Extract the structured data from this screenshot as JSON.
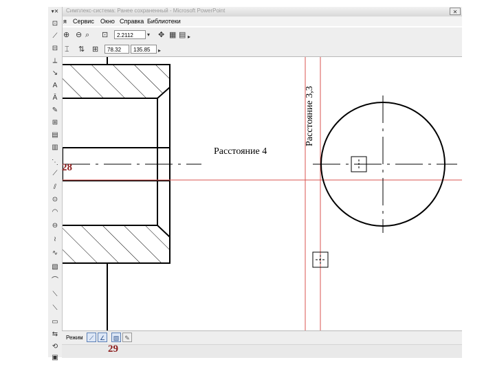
{
  "window": {
    "title": "Симплекс-система: Ранее сохраненный - Microsoft PowerPoint",
    "close_glyph": "✕"
  },
  "menu": {
    "items": [
      "я",
      "Сервис",
      "Окно",
      "Справка",
      "Библиотеки"
    ]
  },
  "toolbar1": {
    "icons": [
      "zoom-in-icon",
      "zoom-out-icon",
      "zoom-scale-icon"
    ],
    "zoom_value": "2.2112",
    "icons_right": [
      "pan-icon",
      "layout-icon",
      "view-icon"
    ]
  },
  "toolbar2": {
    "coord_x": "78.32",
    "coord_y": "135.85"
  },
  "left_toolbar": {
    "icons": [
      "select-icon",
      "line-icon",
      "measure-icon",
      "geometry-icon",
      "dimension-icon",
      "text-icon",
      "symbol-icon",
      "edit-icon",
      "param-icon",
      "attributes-icon",
      "spec-icon",
      "report-icon",
      "line-segment-icon",
      "parallel-line-icon",
      "circle-icon",
      "arc-icon",
      "ellipse-icon",
      "polyline-icon",
      "spline-icon",
      "hatch-icon",
      "fillet-icon",
      "chamfer-icon",
      "contour-icon",
      "offset-icon",
      "mirror-icon",
      "rotate-icon",
      "scale-icon",
      "move-icon"
    ]
  },
  "drawing": {
    "label_distance_4": "Расстояние 4",
    "label_distance_33": "Расстояние 3,3",
    "colors": {
      "line": "#000000",
      "guide": "#d9534f"
    }
  },
  "bottom_bar": {
    "mode_label": "Режим"
  },
  "slide_numbers": {
    "top": "28",
    "bottom": "29"
  }
}
